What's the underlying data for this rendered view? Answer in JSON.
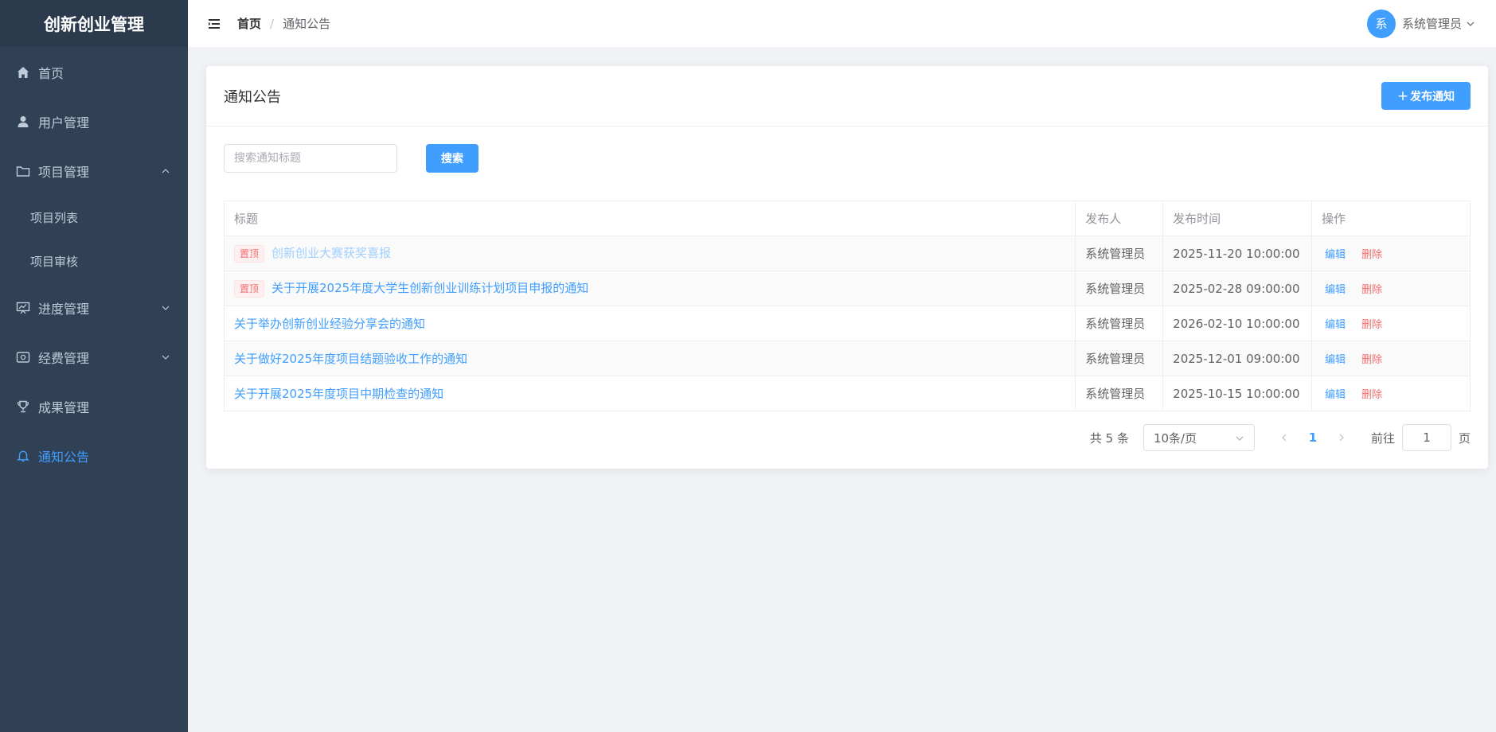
{
  "app": {
    "title": "创新创业管理"
  },
  "sidebar": {
    "items": [
      {
        "label": "首页",
        "icon": "home-icon"
      },
      {
        "label": "用户管理",
        "icon": "user-icon"
      },
      {
        "label": "项目管理",
        "icon": "folder-icon",
        "expanded": true,
        "children": [
          {
            "label": "项目列表"
          },
          {
            "label": "项目审核"
          }
        ]
      },
      {
        "label": "进度管理",
        "icon": "progress-icon"
      },
      {
        "label": "经费管理",
        "icon": "money-icon"
      },
      {
        "label": "成果管理",
        "icon": "trophy-icon"
      },
      {
        "label": "通知公告",
        "icon": "bell-icon",
        "active": true
      }
    ]
  },
  "header": {
    "breadcrumb": {
      "home": "首页",
      "separator": "/",
      "current": "通知公告"
    },
    "user": {
      "avatar_text": "系",
      "name": "系统管理员"
    }
  },
  "card": {
    "title": "通知公告",
    "publish_button": {
      "plus": "+",
      "label": "发布通知"
    }
  },
  "search": {
    "placeholder": "搜索通知标题",
    "button": "搜索"
  },
  "table": {
    "headers": [
      "标题",
      "发布人",
      "发布时间",
      "操作"
    ],
    "rows": [
      {
        "pinned": true,
        "pin_label": "置顶",
        "title": "创新创业大赛获奖喜报",
        "publisher": "系统管理员",
        "time": "2025-11-20 10:00:00",
        "edit": "编辑",
        "delete": "删除"
      },
      {
        "pinned": true,
        "pin_label": "置顶",
        "title": "关于开展2025年度大学生创新创业训练计划项目申报的通知",
        "publisher": "系统管理员",
        "time": "2025-02-28 09:00:00",
        "edit": "编辑",
        "delete": "删除"
      },
      {
        "pinned": false,
        "title": "关于举办创新创业经验分享会的通知",
        "publisher": "系统管理员",
        "time": "2026-02-10 10:00:00",
        "edit": "编辑",
        "delete": "删除"
      },
      {
        "pinned": false,
        "title": "关于做好2025年度项目结题验收工作的通知",
        "publisher": "系统管理员",
        "time": "2025-12-01 09:00:00",
        "edit": "编辑",
        "delete": "删除"
      },
      {
        "pinned": false,
        "title": "关于开展2025年度项目中期检查的通知",
        "publisher": "系统管理员",
        "time": "2025-10-15 10:00:00",
        "edit": "编辑",
        "delete": "删除"
      }
    ]
  },
  "pagination": {
    "total": "共 5 条",
    "page_size": "10条/页",
    "current_page": "1",
    "goto_label": "前往",
    "goto_value": "1",
    "page_suffix": "页"
  },
  "colors": {
    "primary": "#409eff",
    "danger": "#f56c6c",
    "sidebar_bg": "#304156"
  }
}
